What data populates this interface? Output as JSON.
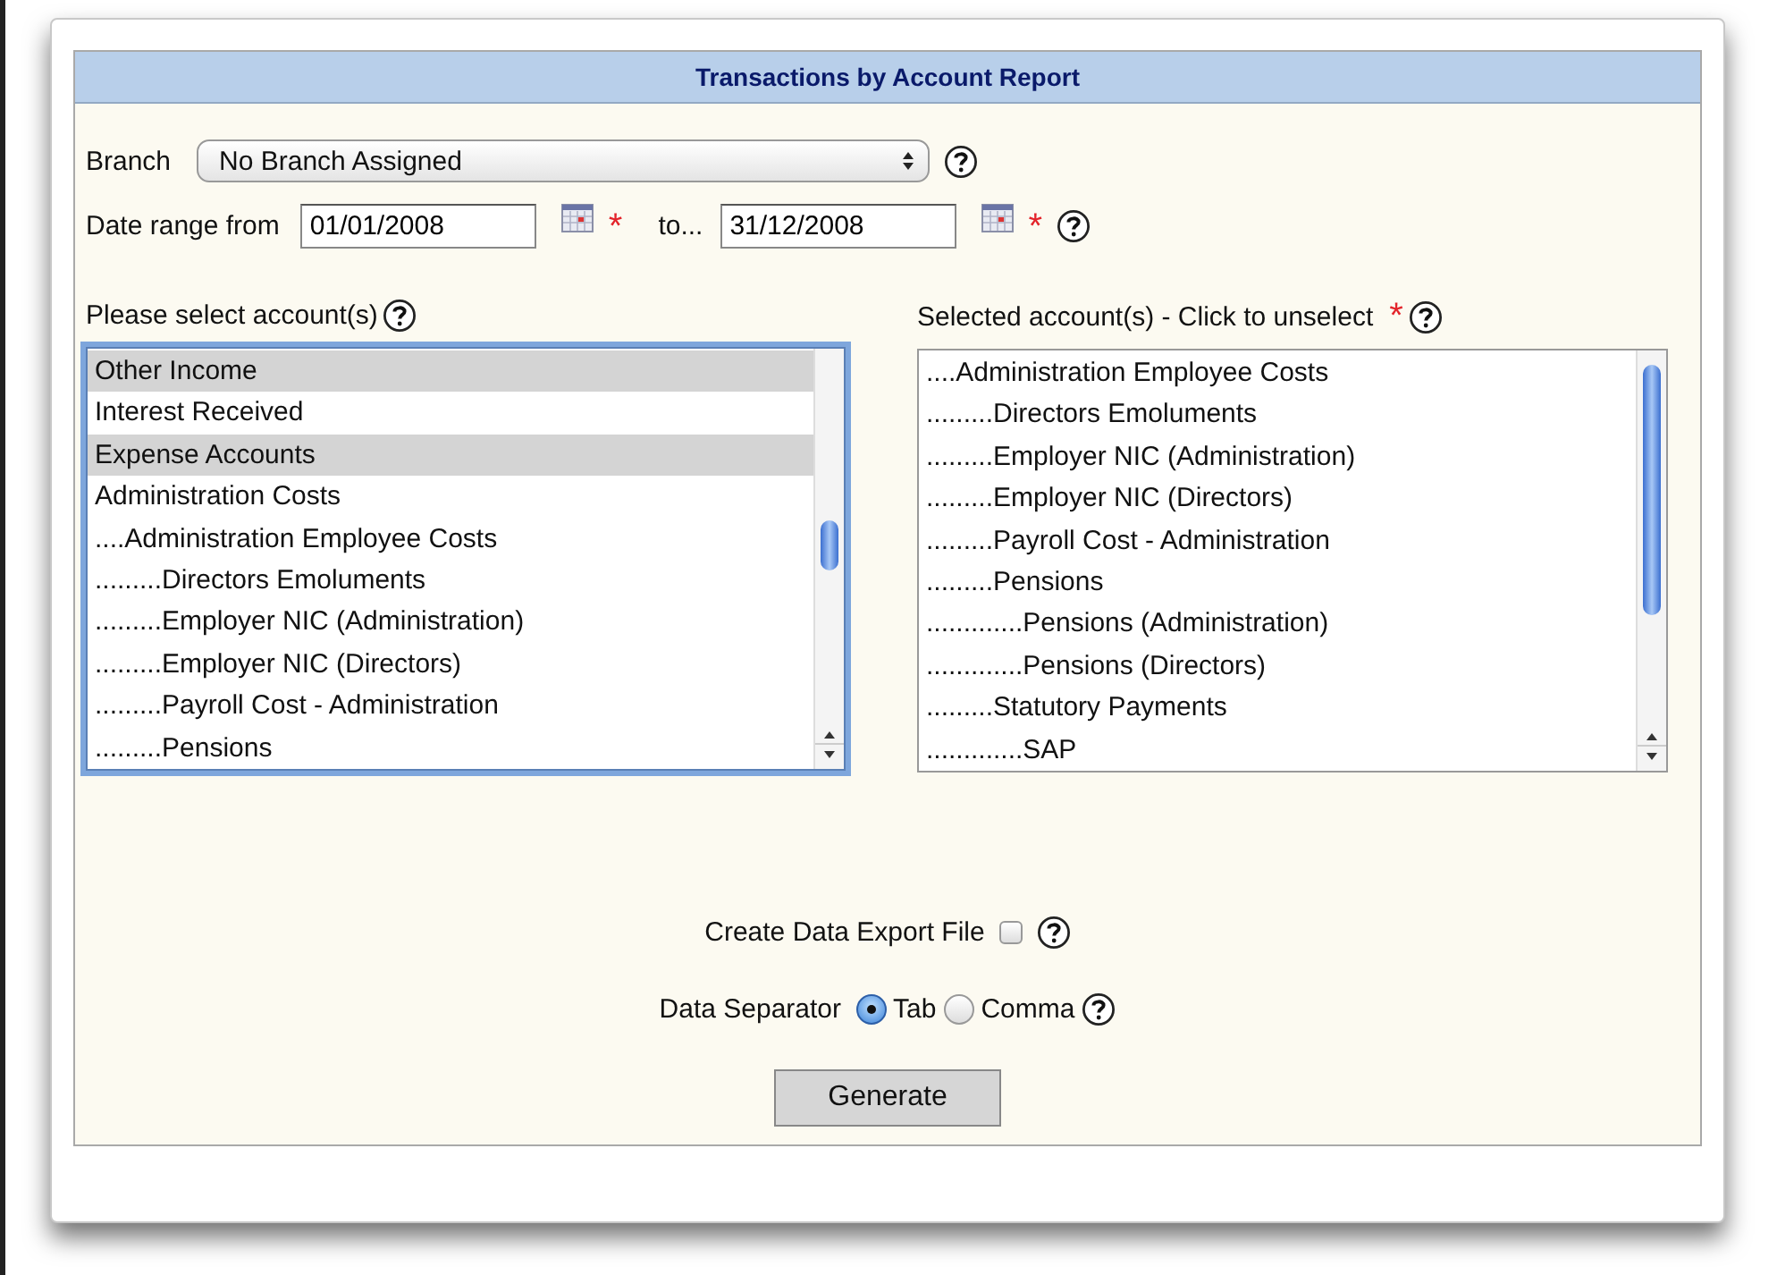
{
  "title": "Transactions by Account Report",
  "branch": {
    "label": "Branch",
    "value": "No Branch Assigned"
  },
  "date_range": {
    "label": "Date range from",
    "from": "01/01/2008",
    "from_required": "*",
    "to_label": "to...",
    "to": "31/12/2008",
    "to_required": "*"
  },
  "available": {
    "label": "Please select account(s)",
    "focused": true,
    "items": [
      {
        "label": "Other Income",
        "selected": true
      },
      {
        "label": "Interest Received",
        "selected": false
      },
      {
        "label": "Expense Accounts",
        "selected": true
      },
      {
        "label": "Administration Costs",
        "selected": false
      },
      {
        "label": "....Administration Employee Costs",
        "selected": false
      },
      {
        "label": ".........Directors Emoluments",
        "selected": false
      },
      {
        "label": ".........Employer NIC (Administration)",
        "selected": false
      },
      {
        "label": ".........Employer NIC (Directors)",
        "selected": false
      },
      {
        "label": ".........Payroll Cost - Administration",
        "selected": false
      },
      {
        "label": ".........Pensions",
        "selected": false
      }
    ]
  },
  "chosen": {
    "label": "Selected account(s) - Click to unselect",
    "required": "*",
    "focused": false,
    "items": [
      {
        "label": "....Administration Employee Costs",
        "selected": false
      },
      {
        "label": ".........Directors Emoluments",
        "selected": false
      },
      {
        "label": ".........Employer NIC (Administration)",
        "selected": false
      },
      {
        "label": ".........Employer NIC (Directors)",
        "selected": false
      },
      {
        "label": ".........Payroll Cost - Administration",
        "selected": false
      },
      {
        "label": ".........Pensions",
        "selected": false
      },
      {
        "label": ".............Pensions (Administration)",
        "selected": false
      },
      {
        "label": ".............Pensions (Directors)",
        "selected": false
      },
      {
        "label": ".........Statutory Payments",
        "selected": false
      },
      {
        "label": ".............SAP",
        "selected": false
      }
    ]
  },
  "export": {
    "label": "Create Data Export File",
    "checked": false
  },
  "separator": {
    "label": "Data Separator",
    "options": [
      {
        "label": "Tab",
        "selected": true
      },
      {
        "label": "Comma",
        "selected": false
      }
    ]
  },
  "button": "Generate"
}
